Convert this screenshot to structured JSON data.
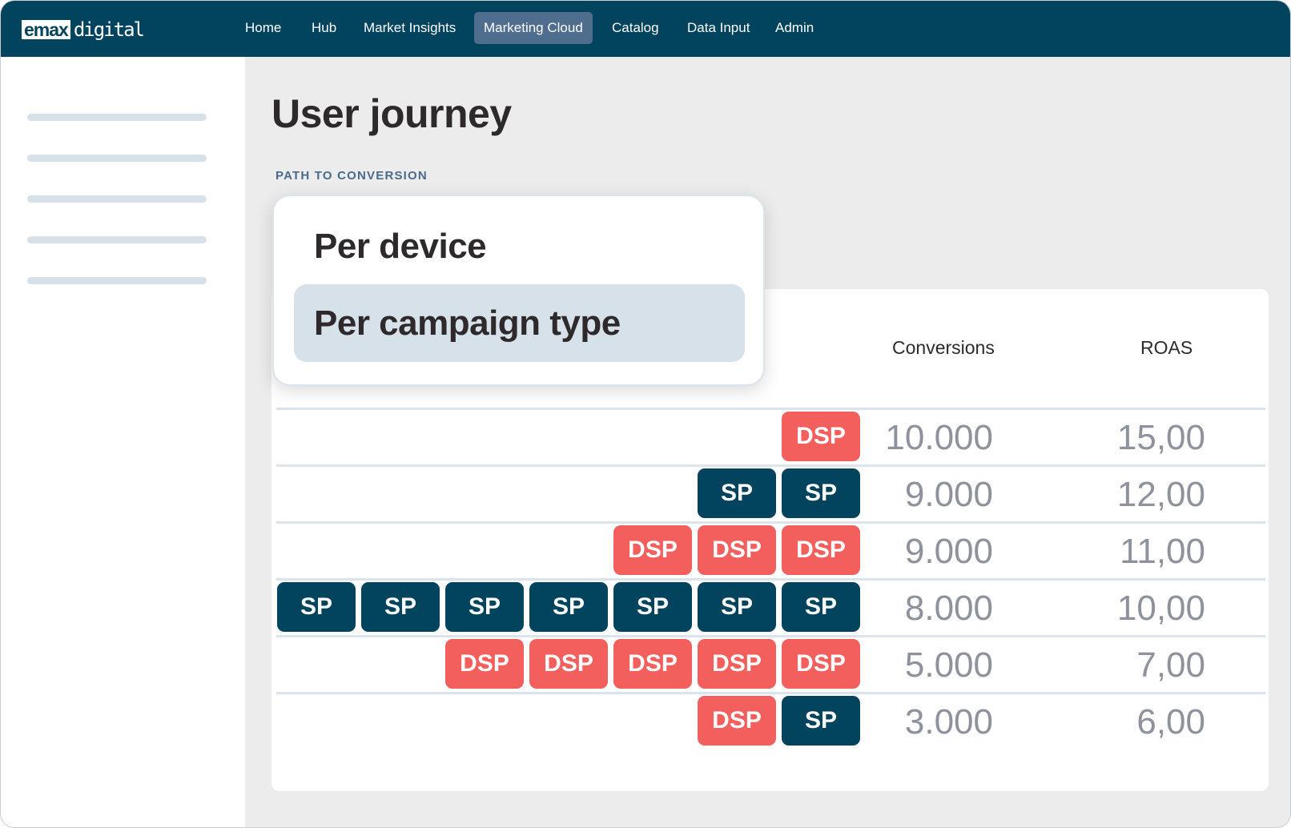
{
  "app": {
    "logo_box": "emax",
    "logo_text": "digital"
  },
  "nav": {
    "items": [
      {
        "label": "Home",
        "active": false
      },
      {
        "label": "Hub",
        "active": false
      },
      {
        "label": "Market Insights",
        "active": false
      },
      {
        "label": "Marketing Cloud",
        "active": true
      },
      {
        "label": "Catalog",
        "active": false
      },
      {
        "label": "Data Input",
        "active": false
      },
      {
        "label": "Admin",
        "active": false
      }
    ]
  },
  "page": {
    "title": "User journey",
    "section_label": "PATH TO CONVERSION"
  },
  "dropdown": {
    "options": [
      {
        "label": "Per device",
        "selected": false
      },
      {
        "label": "Per campaign type",
        "selected": true
      }
    ]
  },
  "table": {
    "columns": [
      "Conversions",
      "ROAS"
    ],
    "rows": [
      {
        "path": [
          "DSP"
        ],
        "conversions": "10.000",
        "roas": "15,00"
      },
      {
        "path": [
          "SP",
          "SP"
        ],
        "conversions": "9.000",
        "roas": "12,00"
      },
      {
        "path": [
          "DSP",
          "DSP",
          "DSP"
        ],
        "conversions": "9.000",
        "roas": "11,00"
      },
      {
        "path": [
          "SP",
          "SP",
          "SP",
          "SP",
          "SP",
          "SP",
          "SP"
        ],
        "conversions": "8.000",
        "roas": "10,00"
      },
      {
        "path": [
          "DSP",
          "DSP",
          "DSP",
          "DSP",
          "DSP"
        ],
        "conversions": "5.000",
        "roas": "7,00"
      },
      {
        "path": [
          "DSP",
          "SP"
        ],
        "conversions": "3.000",
        "roas": "6,00"
      }
    ]
  },
  "colors": {
    "nav": "#02445d",
    "dsp": "#f25f5c",
    "sp": "#02445d",
    "active_nav": "#4f6e8d",
    "selected_option": "#d7e1ea"
  }
}
